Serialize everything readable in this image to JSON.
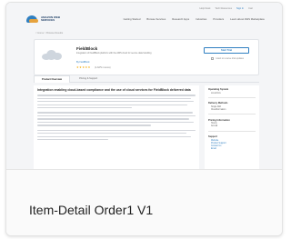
{
  "caption": "Item-Detail Order1 V1",
  "colors": {
    "accent": "#2f7fc1",
    "rating": "#f2a900",
    "logo_secondary": "#e6a23c"
  },
  "mockup": {
    "util_links": [
      "Help Desk",
      "Tech Resources",
      "Sign In",
      "Cart"
    ],
    "logo_text": "AMAZON WEB SERVICES",
    "nav_links": [
      "Getting Started",
      "Browse Services",
      "Research Apps",
      "Industries",
      "Providers",
      "Learn about AWS Marketplace"
    ],
    "breadcrumb": "< Home > Browse Results",
    "product": {
      "title": "FieldBlock",
      "description": "Integration of FieldBlock platform with the AWS cloud for secure data handling",
      "vendor": "By FieldBlock",
      "stars": "★★★★★",
      "rating_count": "(2 AWS reviews)",
      "cta_label": "Start Trial",
      "cta_checkbox": "I want to receive trial updates"
    },
    "tabs": [
      "Product Overview",
      "Pricing & Support"
    ],
    "main_heading": "Integration enabling cloud-based compliance and the use of cloud services for FieldBlock delivered data",
    "sidebar": [
      {
        "heading": "Operating System",
        "items": [
          "Linux/Unix"
        ],
        "link": false
      },
      {
        "heading": "Delivery Methods",
        "items": [
          "Single AMI",
          "CloudFormation"
        ],
        "link": false
      },
      {
        "heading": "Pricing Information",
        "items": [
          "Hourly",
          "Annual"
        ],
        "link": false
      },
      {
        "heading": "Support",
        "items": [
          "Website",
          "Product Support",
          "Contact Us",
          "Email"
        ],
        "link": true
      }
    ]
  }
}
